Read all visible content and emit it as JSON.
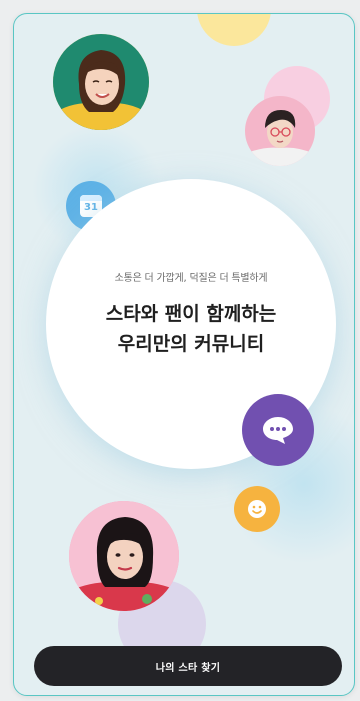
{
  "hero": {
    "subtitle": "소통은 더 가깝게, 덕질은 더 특별하게",
    "title_line1": "스타와 팬이 함께하는",
    "title_line2": "우리만의 커뮤니티"
  },
  "icons": {
    "calendar": {
      "name": "calendar-icon",
      "day": "31",
      "color": "#5eb2e6"
    },
    "chat": {
      "name": "chat-bubble-icon",
      "color": "#7150b0"
    },
    "smile": {
      "name": "smile-icon",
      "color": "#f6b33f"
    }
  },
  "cta": {
    "label": "나의 스타 찾기",
    "color": "#232327"
  },
  "colors": {
    "background": "#e3eff2",
    "frame_border": "#59c6c4"
  }
}
